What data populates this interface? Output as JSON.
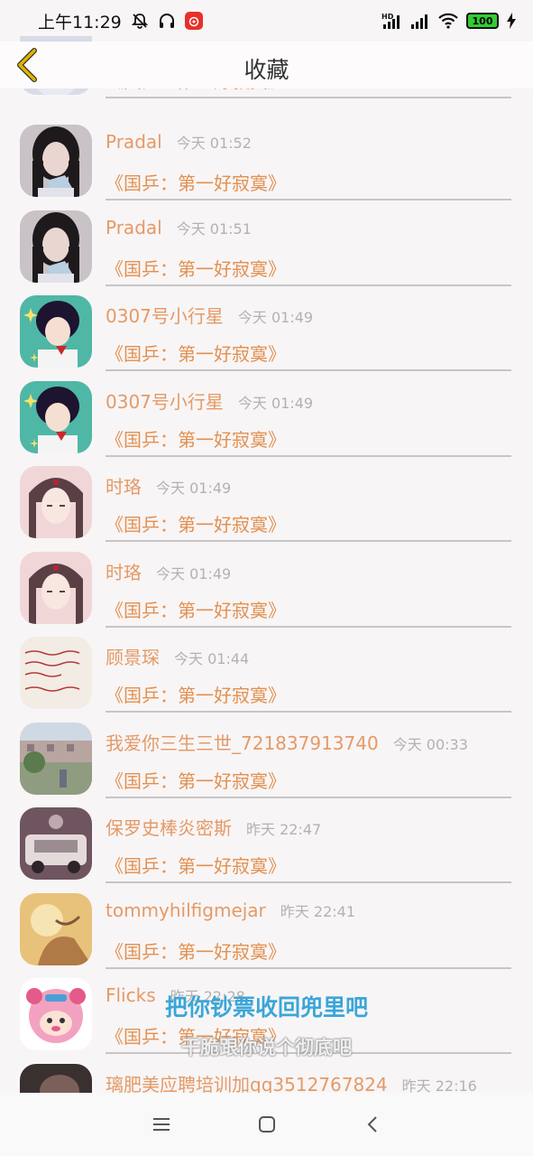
{
  "status_bar": {
    "time": "上午11:29",
    "battery": "100",
    "network_label": "HD"
  },
  "header": {
    "title": "收藏"
  },
  "list": {
    "partial_top_message": "《国乒：第一好寂寞》",
    "items": [
      {
        "name": "Pradal",
        "time": "今天 01:52",
        "message": "《国乒：第一好寂寞》",
        "avatar": "girl-photo-icon"
      },
      {
        "name": "Pradal",
        "time": "今天 01:51",
        "message": "《国乒：第一好寂寞》",
        "avatar": "girl-photo-icon"
      },
      {
        "name": "0307号小行星",
        "time": "今天 01:49",
        "message": "《国乒：第一好寂寞》",
        "avatar": "anime-girl-icon"
      },
      {
        "name": "0307号小行星",
        "time": "今天 01:49",
        "message": "《国乒：第一好寂寞》",
        "avatar": "anime-girl-icon"
      },
      {
        "name": "时珞",
        "time": "今天 01:49",
        "message": "《国乒：第一好寂寞》",
        "avatar": "anime-boy-icon"
      },
      {
        "name": "时珞",
        "time": "今天 01:49",
        "message": "《国乒：第一好寂寞》",
        "avatar": "anime-boy-icon"
      },
      {
        "name": "顾景琛",
        "time": "今天 01:44",
        "message": "《国乒：第一好寂寞》",
        "avatar": "handwriting-icon"
      },
      {
        "name": "我爱你三生三世_721837913740",
        "time": "今天 00:33",
        "message": "《国乒：第一好寂寞》",
        "avatar": "street-photo-icon"
      },
      {
        "name": "保罗史棒炎密斯",
        "time": "昨天 22:47",
        "message": "《国乒：第一好寂寞》",
        "avatar": "car-photo-icon"
      },
      {
        "name": "tommyhilfigmejar",
        "time": "昨天 22:41",
        "message": "《国乒：第一好寂寞》",
        "avatar": "sunset-photo-icon"
      },
      {
        "name": "Flicks",
        "time": "昨天 22:28",
        "message": "《国乒：第一好寂寞》",
        "avatar": "pink-cartoon-icon"
      },
      {
        "name": "璃肥美应聘培训加qq3512767824",
        "time": "昨天 22:16",
        "message": "",
        "avatar": "dark-photo-icon"
      }
    ]
  },
  "captions": {
    "line1": "把你钞票收回兜里吧",
    "line2": "干脆跟你说个彻底吧"
  },
  "colors": {
    "accent_name": "#e49a66",
    "accent_message": "#e2904f",
    "time_gray": "#b2b2b2",
    "caption_blue": "#3aa6d8",
    "back_arrow": "#e0b400"
  }
}
